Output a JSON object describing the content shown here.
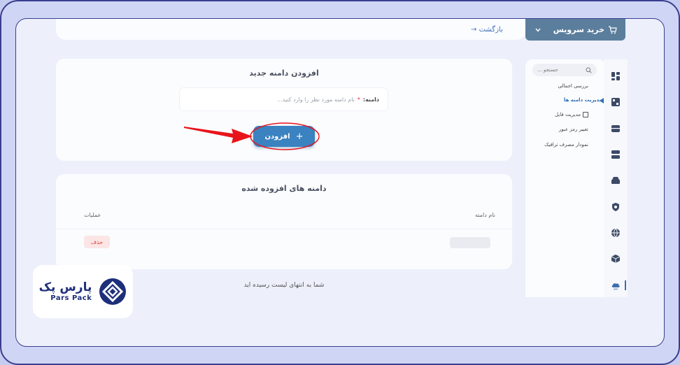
{
  "header": {
    "back_label": "→ بازگشت",
    "buy_service_label": "خرید سرویس"
  },
  "add_domain": {
    "title": "افزودن دامنه جدید",
    "field_label": "دامنه:",
    "field_required_mark": "*",
    "field_placeholder": "نام دامنه مورد نظر را وارد کنید...",
    "add_button_label": "افزودن",
    "add_button_icon": "+"
  },
  "domain_list": {
    "title": "دامنه های افزوده شده",
    "columns": {
      "name": "نام دامنه",
      "actions": "عملیات"
    },
    "rows": [
      {
        "delete_label": "حذف"
      }
    ],
    "end_text": "شما به انتهای لیست رسیده اید"
  },
  "sidebar": {
    "search_placeholder": "جستجو ...",
    "items": [
      {
        "label": "بررسی اجمالی"
      },
      {
        "label": "مدیریت دامنه ها"
      },
      {
        "label": "مدیریت فایل"
      },
      {
        "label": "تغییر رمز عبور"
      },
      {
        "label": "نمودار مصرف ترافیک"
      }
    ]
  },
  "logo": {
    "fa_text": "پارس پک",
    "en_text": "Pars Pack"
  },
  "colors": {
    "accent": "#3a82c0",
    "annotation_red": "#e8141b",
    "brand": "#1e2f7a"
  }
}
